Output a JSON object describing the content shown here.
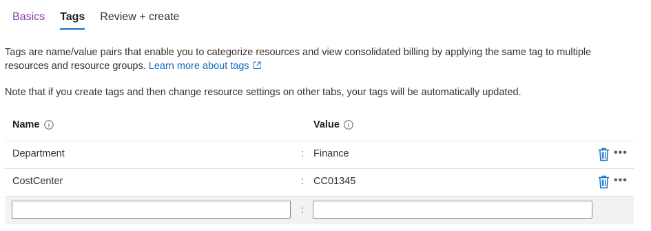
{
  "tabs": [
    {
      "label": "Basics"
    },
    {
      "label": "Tags"
    },
    {
      "label": "Review + create"
    }
  ],
  "description": {
    "text": "Tags are name/value pairs that enable you to categorize resources and view consolidated billing by applying the same tag to multiple resources and resource groups.",
    "link_label": "Learn more about tags"
  },
  "note": "Note that if you create tags and then change resource settings on other tabs, your tags will be automatically updated.",
  "columns": {
    "name": "Name",
    "value": "Value"
  },
  "separator": ":",
  "more_label": "•••",
  "tags": [
    {
      "name": "Department",
      "value": "Finance"
    },
    {
      "name": "CostCenter",
      "value": "CC01345"
    }
  ],
  "new_tag": {
    "name": "",
    "value": ""
  },
  "colors": {
    "accent": "#0f6cbd",
    "visited_tab": "#8a3aa8",
    "trash_icon": "#0f6cbd"
  }
}
